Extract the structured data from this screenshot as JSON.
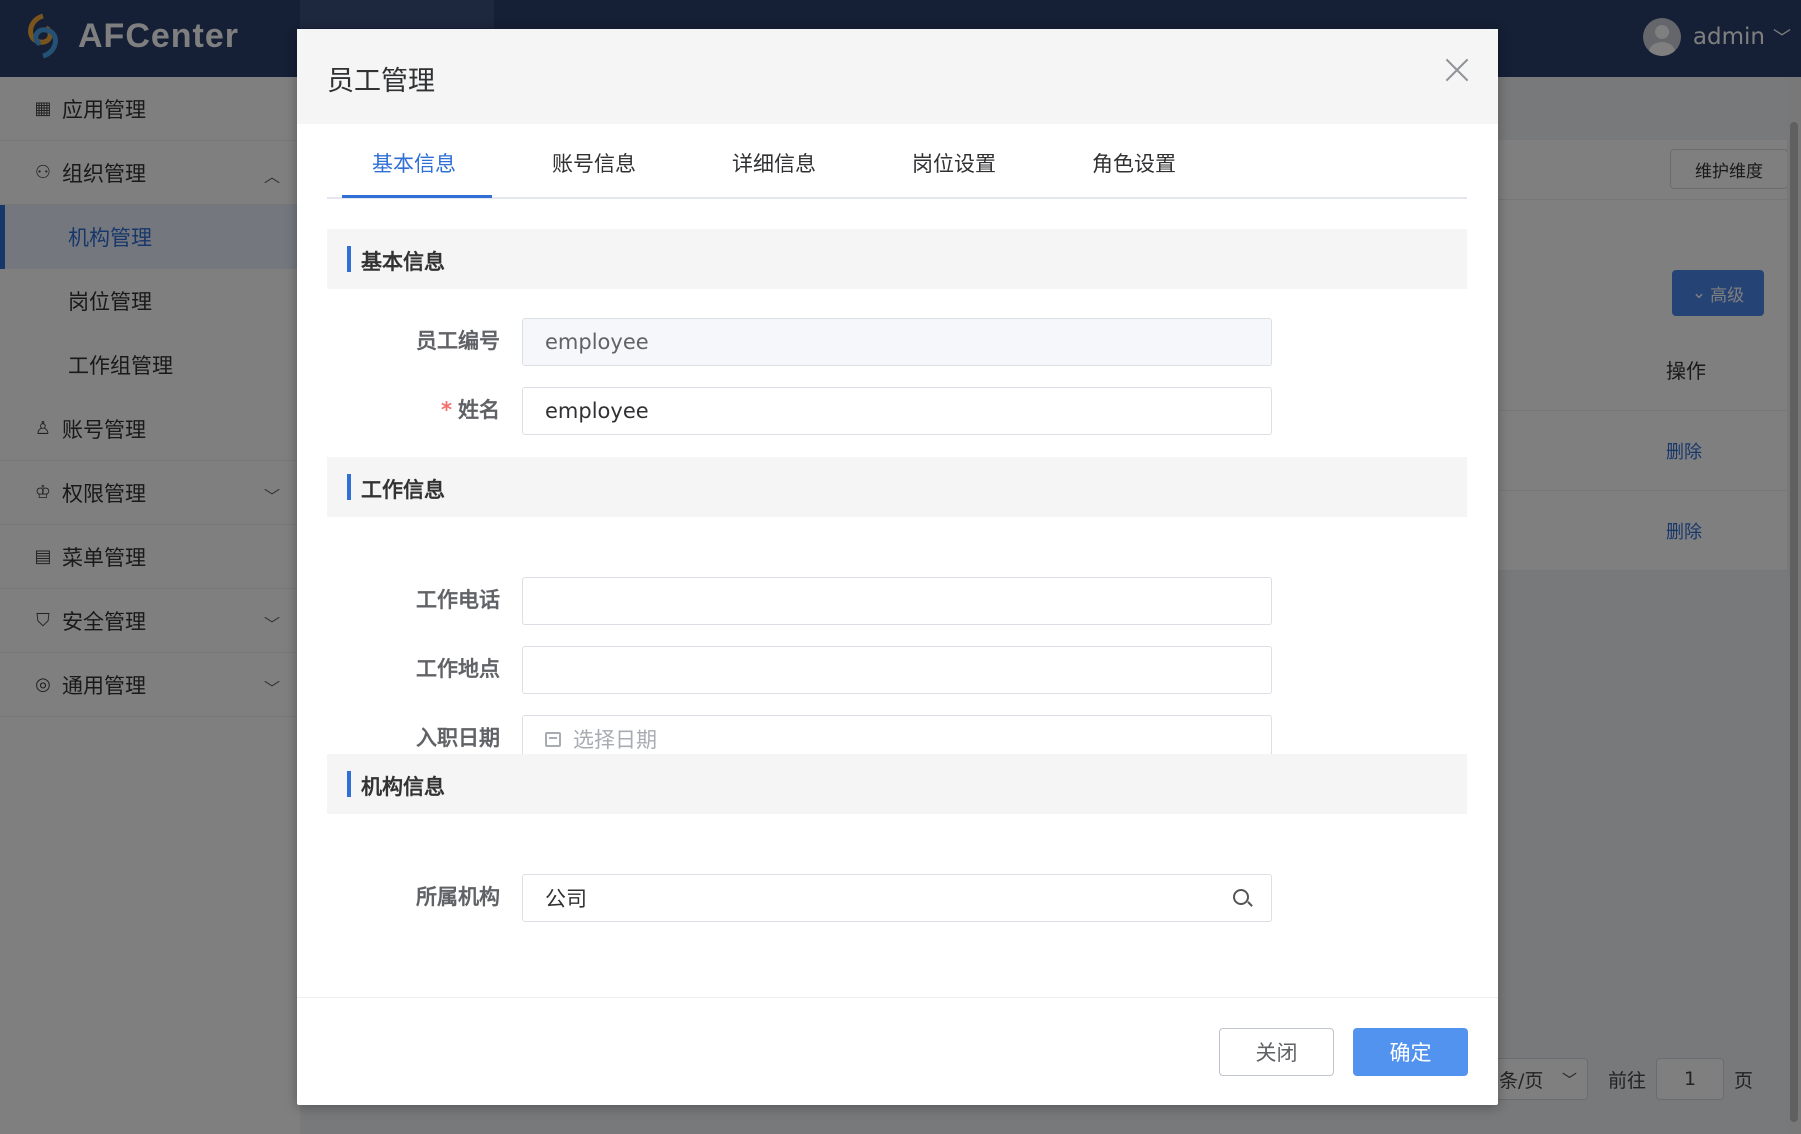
{
  "app": {
    "logo_text": "AFCenter",
    "user_name": "admin"
  },
  "sidebar": {
    "items": [
      {
        "label": "应用管理",
        "icon": "grid-icon"
      },
      {
        "label": "组织管理",
        "icon": "users-icon",
        "expanded": true
      },
      {
        "label": "机构管理",
        "icon": "",
        "active": true
      },
      {
        "label": "岗位管理",
        "icon": ""
      },
      {
        "label": "工作组管理",
        "icon": ""
      },
      {
        "label": "账号管理",
        "icon": "user-icon"
      },
      {
        "label": "权限管理",
        "icon": "permission-icon"
      },
      {
        "label": "菜单管理",
        "icon": "menu-icon"
      },
      {
        "label": "安全管理",
        "icon": "shield-icon"
      },
      {
        "label": "通用管理",
        "icon": "settings-icon"
      }
    ]
  },
  "background": {
    "maintain_dim_label": "维护维度",
    "advanced_label": "高级",
    "op_header": "操作",
    "delete_label": "删除",
    "pager": {
      "page_size_suffix": "条/页",
      "goto_prefix": "前往",
      "goto_value": "1",
      "goto_suffix": "页"
    }
  },
  "modal": {
    "title": "员工管理",
    "tabs": [
      "基本信息",
      "账号信息",
      "详细信息",
      "岗位设置",
      "角色设置"
    ],
    "active_tab": 0,
    "sections": {
      "basic": "基本信息",
      "work": "工作信息",
      "org": "机构信息"
    },
    "fields": {
      "employee_no": {
        "label": "员工编号",
        "value": "employee"
      },
      "name": {
        "label": "姓名",
        "value": "employee",
        "required_mark": "*"
      },
      "work_phone": {
        "label": "工作电话",
        "value": ""
      },
      "work_location": {
        "label": "工作地点",
        "value": ""
      },
      "hire_date": {
        "label": "入职日期",
        "placeholder": "选择日期"
      },
      "org": {
        "label": "所属机构",
        "value": "公司"
      }
    },
    "buttons": {
      "close": "关闭",
      "confirm": "确定"
    }
  },
  "colors": {
    "primary": "#2f6fd6",
    "header_bg": "#2b3f6b",
    "confirm_bg": "#5393f0"
  }
}
